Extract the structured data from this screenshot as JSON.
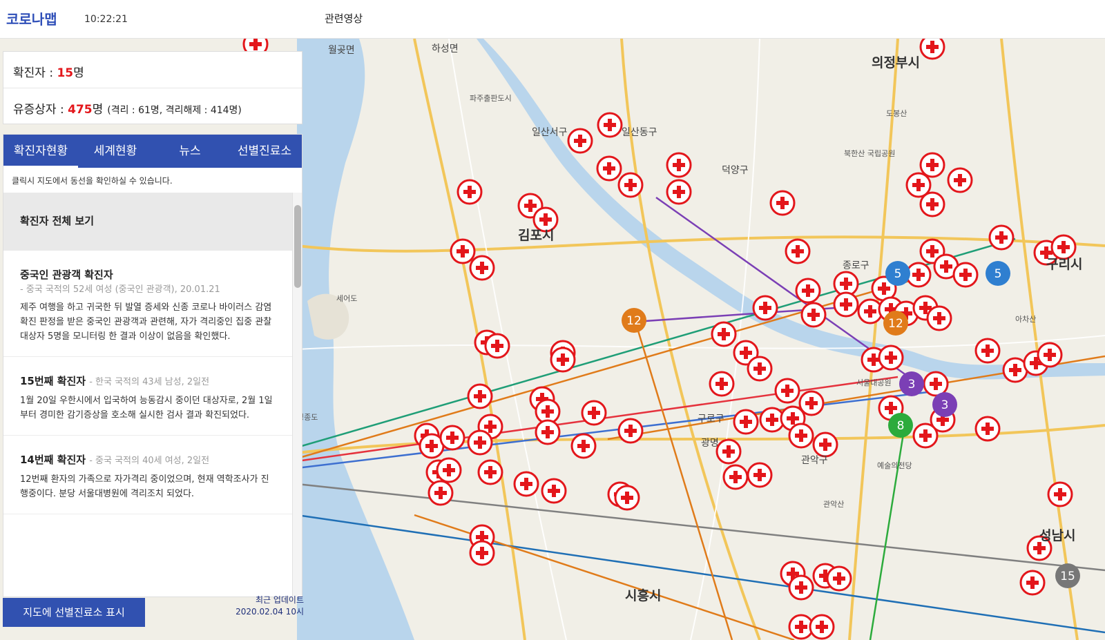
{
  "header": {
    "brand": "코로나맵",
    "clock": "10:22:21",
    "nav_video": "관련영상"
  },
  "stats": {
    "confirmed_label": "확진자 : ",
    "confirmed_value": "15",
    "confirmed_unit": "명",
    "suspected_label": "유증상자 : ",
    "suspected_value": "475",
    "suspected_unit": "명",
    "suspected_detail": "(격리 : 61명, 격리해제 : 414명)"
  },
  "tabs": [
    {
      "label": "확진자현황"
    },
    {
      "label": "세계현황"
    },
    {
      "label": "뉴스"
    },
    {
      "label": "선별진료소"
    }
  ],
  "panel": {
    "hint": "클릭시 지도에서 동선을 확인하실 수 있습니다.",
    "all_label": "확진자 전체 보기",
    "cases": [
      {
        "title": "중국인 관광객 확진자",
        "meta": "- 중국 국적의 52세 여성 (중국인 관광객), 20.01.21",
        "desc": "제주 여행을 하고 귀국한 뒤 발열 증세와 신종 코로나 바이러스 감염 확진 판정을 받은 중국인 관광객과 관련해, 자가 격리중인 집중 관찰 대상자 5명을 모니터링 한 결과 이상이 없음을 확인했다."
      },
      {
        "title": "15번째 확진자",
        "meta": "- 한국 국적의 43세 남성, 2일전",
        "desc": "1월 20일 우한시에서 입국하여 능동감시 중이던 대상자로, 2월 1일부터 경미한 감기증상을 호소해 실시한 검사 결과 확진되었다."
      },
      {
        "title": "14번째 확진자",
        "meta": "- 중국 국적의 40세 여성, 2일전",
        "desc": "12번째 환자의 가족으로 자가격리 중이었으며, 현재 역학조사가 진행중이다. 분당 서울대병원에 격리조치 되었다."
      }
    ]
  },
  "clinic_button": "지도에 선별진료소 표시",
  "update": {
    "label": "최근 업데이트",
    "date": "2020.02.04 10시"
  },
  "map": {
    "places": [
      "의정부시",
      "김포시",
      "구리시",
      "시흥시",
      "성남시",
      "월곶면",
      "하성면",
      "일산서구",
      "일산동구",
      "덕양구",
      "종로구",
      "구로구",
      "광명",
      "관악구",
      "파주출판도시",
      "세어도",
      "영종도",
      "서울대공원",
      "예술의전당",
      "도봉산",
      "북한산 국립공원",
      "관악산",
      "아차산"
    ],
    "clusters": [
      "5",
      "12",
      "3",
      "3",
      "8",
      "15",
      "12",
      "5"
    ],
    "accent": "#3151b0",
    "marker_color": "#e3161b"
  }
}
